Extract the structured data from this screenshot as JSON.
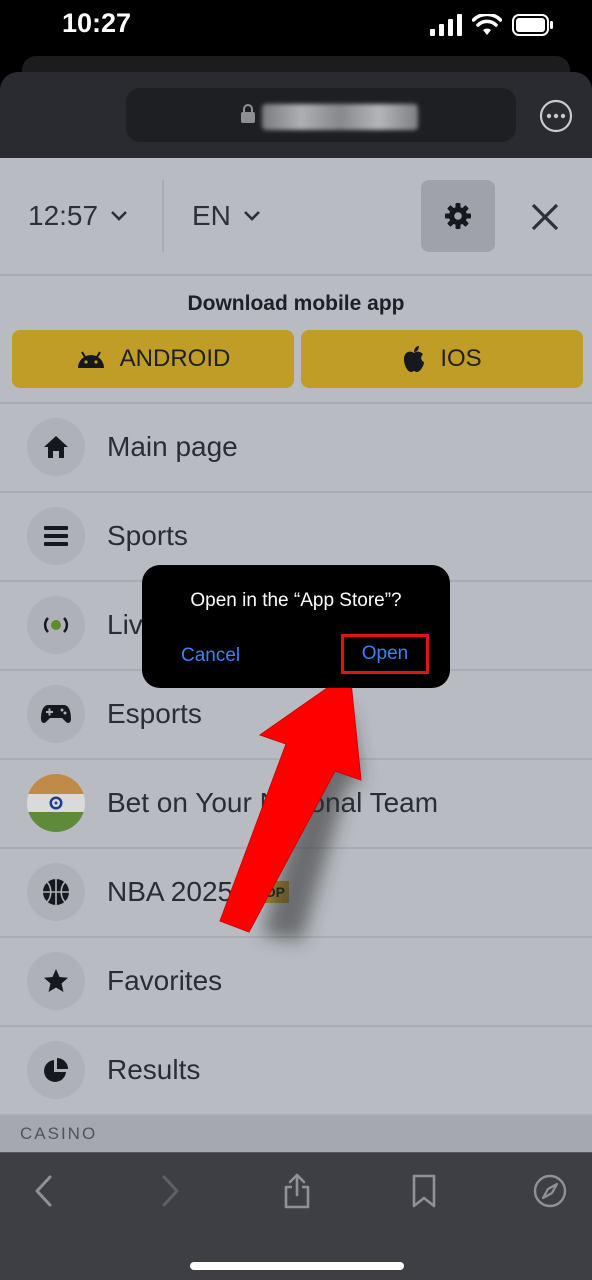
{
  "status_bar": {
    "time": "10:27"
  },
  "header": {
    "time_selector": "12:57",
    "language_selector": "EN"
  },
  "download": {
    "title": "Download mobile app",
    "android_label": "ANDROID",
    "ios_label": "IOS"
  },
  "menu": {
    "items": [
      {
        "label": "Main page",
        "icon": "home-icon"
      },
      {
        "label": "Sports",
        "icon": "list-icon"
      },
      {
        "label": "Live",
        "icon": "live-icon"
      },
      {
        "label": "Esports",
        "icon": "gamepad-icon"
      },
      {
        "label": "Bet on Your National Team",
        "icon": "india-flag-icon"
      },
      {
        "label": "NBA 2025",
        "icon": "basketball-icon",
        "badge": "TOP"
      },
      {
        "label": "Favorites",
        "icon": "star-icon"
      },
      {
        "label": "Results",
        "icon": "pie-chart-icon"
      }
    ]
  },
  "section": {
    "casino_label": "CASINO"
  },
  "dialog": {
    "message": "Open in the “App Store”?",
    "cancel_label": "Cancel",
    "open_label": "Open"
  },
  "colors": {
    "accent_button": "#bf9d27",
    "link_blue": "#3a82f6",
    "highlight_red": "#e3111b",
    "dimmed_background": "#b8bcc2"
  }
}
